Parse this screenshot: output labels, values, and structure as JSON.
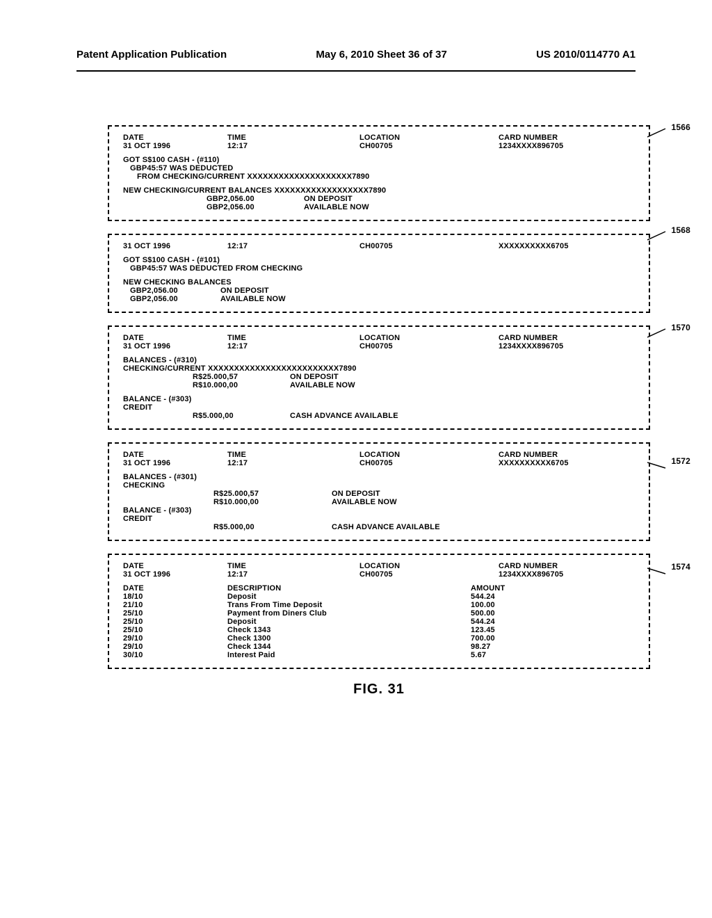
{
  "header": {
    "left": "Patent Application Publication",
    "center": "May 6, 2010  Sheet 36 of 37",
    "right": "US 2010/0114770 A1"
  },
  "labels": {
    "date": "DATE",
    "time": "TIME",
    "location": "LOCATION",
    "card": "CARD NUMBER",
    "description": "DESCRIPTION",
    "amount": "AMOUNT"
  },
  "common": {
    "date_val": "31 OCT 1996",
    "time_val": "12:17",
    "loc_val": "CH00705",
    "card_a": "1234XXXX896705",
    "card_b": "XXXXXXXXXX6705"
  },
  "p1": {
    "ref": "1566",
    "l1": "GOT S$100 CASH - (#110)",
    "l2": "GBP45:57 WAS DEDUCTED",
    "l3": "FROM CHECKING/CURRENT XXXXXXXXXXXXXXXXXXXX7890",
    "l4": "NEW CHECKING/CURRENT BALANCES XXXXXXXXXXXXXXXXXX7890",
    "b1a": "GBP2,056.00",
    "b1b": "ON DEPOSIT",
    "b2a": "GBP2,056.00",
    "b2b": "AVAILABLE NOW"
  },
  "p2": {
    "ref": "1568",
    "l1": "GOT S$100 CASH - (#101)",
    "l2": "GBP45:57 WAS DEDUCTED FROM CHECKING",
    "l3": "NEW CHECKING BALANCES",
    "b1a": "GBP2,056.00",
    "b1b": "ON DEPOSIT",
    "b2a": "GBP2,056.00",
    "b2b": "AVAILABLE NOW"
  },
  "p3": {
    "ref": "1570",
    "l1": "BALANCES - (#310)",
    "l2": "CHECKING/CURRENT  XXXXXXXXXXXXXXXXXXXXXXXXX7890",
    "b1a": "R$25.000,57",
    "b1b": "ON DEPOSIT",
    "b2a": "R$10.000,00",
    "b2b": "AVAILABLE NOW",
    "l3": "BALANCE - (#303)",
    "l4": "CREDIT",
    "b3a": "R$5.000,00",
    "b3b": "CASH ADVANCE AVAILABLE"
  },
  "p4": {
    "ref": "1572",
    "l1": "BALANCES - (#301)",
    "l2": "CHECKING",
    "b1a": "R$25.000,57",
    "b1b": "ON DEPOSIT",
    "b2a": "R$10.000,00",
    "b2b": "AVAILABLE NOW",
    "l3": "BALANCE - (#303)",
    "l4": "CREDIT",
    "b3a": "R$5.000,00",
    "b3b": "CASH ADVANCE AVAILABLE"
  },
  "p5": {
    "ref": "1574",
    "tx": [
      {
        "d": "18/10",
        "desc": "Deposit",
        "amt": "544.24"
      },
      {
        "d": "21/10",
        "desc": "Trans From Time Deposit",
        "amt": "100.00"
      },
      {
        "d": "25/10",
        "desc": "Payment from Diners Club",
        "amt": "500.00"
      },
      {
        "d": "25/10",
        "desc": "Deposit",
        "amt": "544.24"
      },
      {
        "d": "25/10",
        "desc": "Check 1343",
        "amt": "123.45"
      },
      {
        "d": "29/10",
        "desc": "Check 1300",
        "amt": "700.00"
      },
      {
        "d": "29/10",
        "desc": "Check 1344",
        "amt": "98.27"
      },
      {
        "d": "30/10",
        "desc": "Interest Paid",
        "amt": "5.67"
      }
    ]
  },
  "figure": "FIG. 31"
}
